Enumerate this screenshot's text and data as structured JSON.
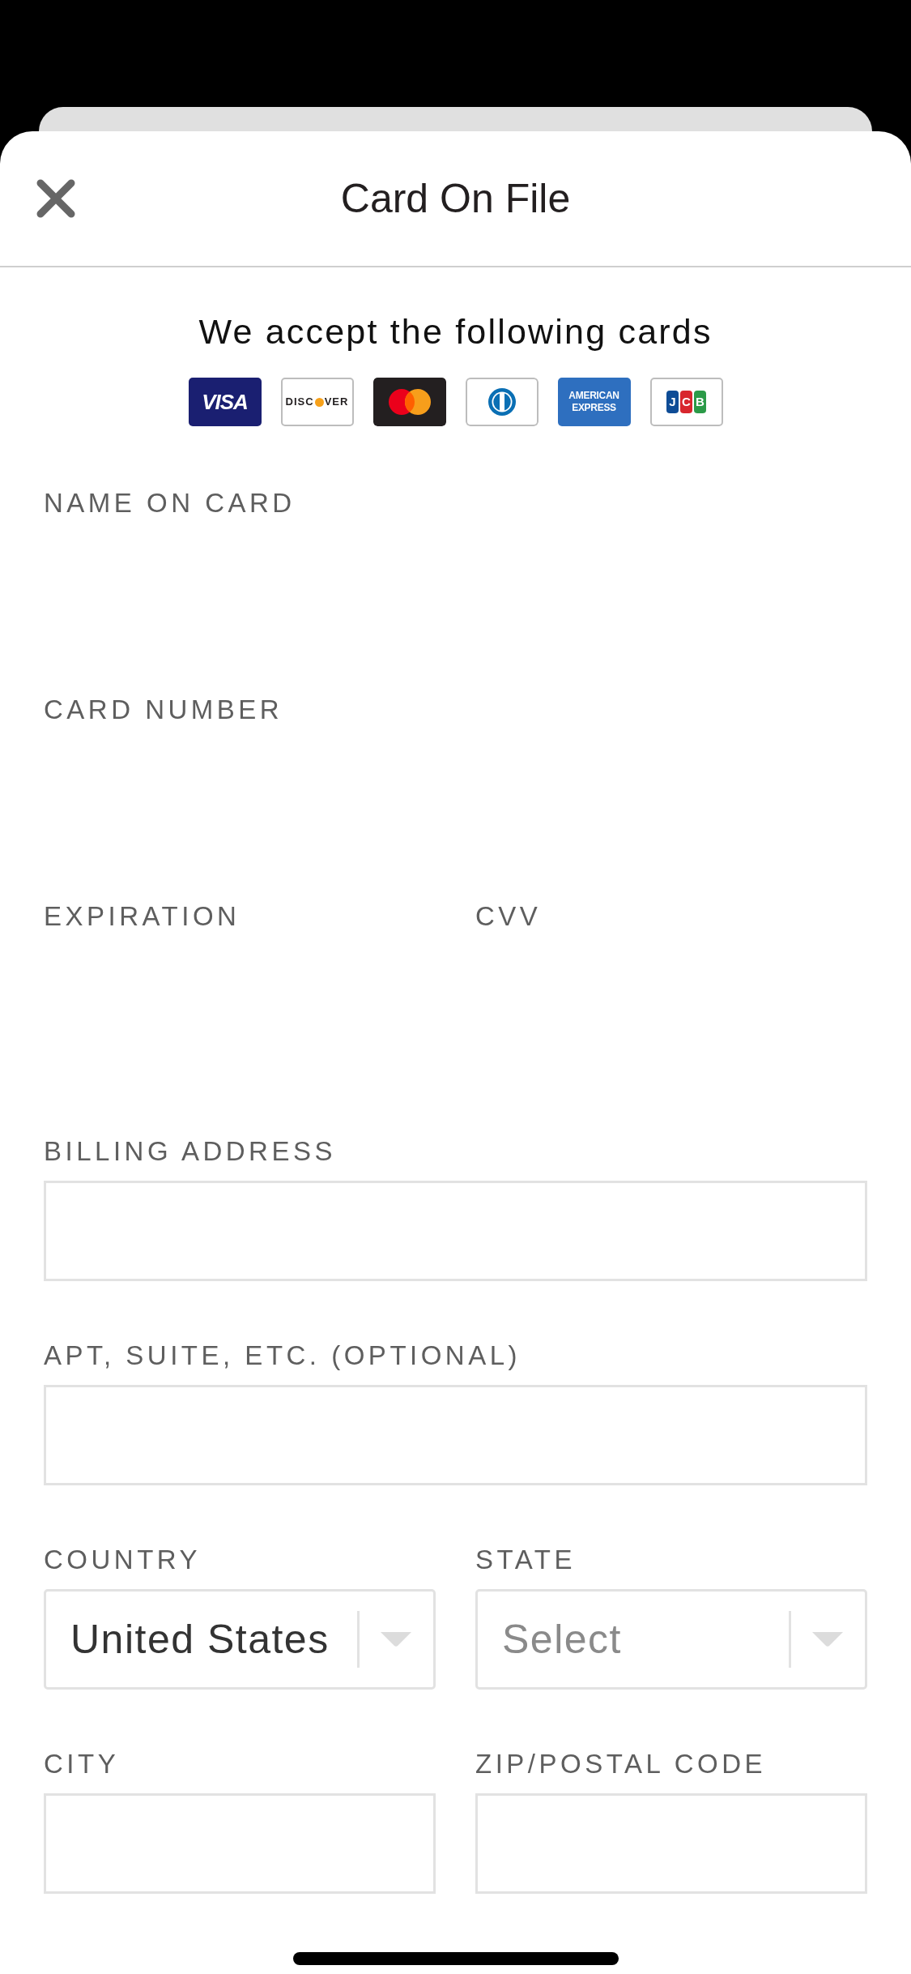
{
  "sheet": {
    "title": "Card On File"
  },
  "accepted_cards": {
    "heading": "We accept the following cards",
    "cards": [
      {
        "kind": "visa",
        "text": "VISA"
      },
      {
        "kind": "discover",
        "parts": [
          "DISC",
          "VER"
        ]
      },
      {
        "kind": "mastercard"
      },
      {
        "kind": "diners"
      },
      {
        "kind": "amex",
        "text": "AMERICAN EXPRESS"
      },
      {
        "kind": "jcb",
        "letters": [
          {
            "text": "J",
            "color": "#0e4c96"
          },
          {
            "text": "C",
            "color": "#d8262d"
          },
          {
            "text": "B",
            "color": "#2b9a48"
          }
        ]
      }
    ]
  },
  "form_rows": [
    {
      "fields": [
        {
          "label": "NAME ON CARD",
          "kind": "hosted"
        }
      ]
    },
    {
      "fields": [
        {
          "label": "CARD NUMBER",
          "kind": "hosted"
        }
      ]
    },
    {
      "fields": [
        {
          "label": "EXPIRATION",
          "kind": "hosted"
        },
        {
          "label": "CVV",
          "kind": "hosted"
        }
      ]
    },
    {
      "fields": [
        {
          "label": "BILLING ADDRESS",
          "kind": "text"
        }
      ]
    },
    {
      "fields": [
        {
          "label": "APT, SUITE, ETC. (OPTIONAL)",
          "kind": "text"
        }
      ]
    },
    {
      "fields": [
        {
          "label": "COUNTRY",
          "kind": "select",
          "value": "United States"
        },
        {
          "label": "STATE",
          "kind": "select",
          "placeholder": "Select"
        }
      ]
    },
    {
      "fields": [
        {
          "label": "CITY",
          "kind": "text"
        },
        {
          "label": "ZIP/POSTAL CODE",
          "kind": "text"
        }
      ]
    }
  ]
}
